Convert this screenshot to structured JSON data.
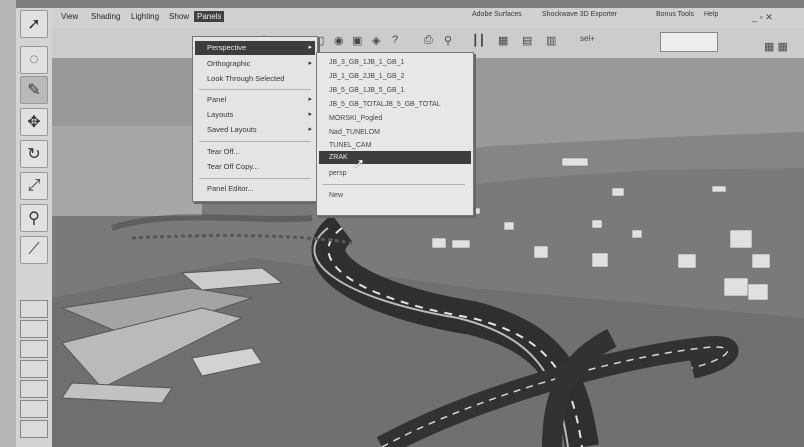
{
  "menubar": {
    "items": [
      "View",
      "Shading",
      "Lighting",
      "Show",
      "Panels"
    ],
    "active_index": 4,
    "right_items": [
      "Adobe Surfaces",
      "Shockwave 3D Exporter",
      "Bonus Tools",
      "Help"
    ]
  },
  "toolbar": {
    "field_prefix": "sel+",
    "field_value": ""
  },
  "panels_menu": {
    "items": [
      {
        "label": "Perspective",
        "submenu": true,
        "selected": true
      },
      {
        "label": "Orthographic",
        "submenu": true
      },
      {
        "label": "Look Through Selected"
      },
      {
        "separator": true
      },
      {
        "label": "Panel",
        "submenu": true
      },
      {
        "label": "Layouts",
        "submenu": true
      },
      {
        "label": "Saved Layouts",
        "submenu": true
      },
      {
        "separator": true
      },
      {
        "label": "Tear Off..."
      },
      {
        "label": "Tear Off Copy..."
      },
      {
        "separator": true
      },
      {
        "label": "Panel Editor..."
      }
    ]
  },
  "perspective_submenu": {
    "items": [
      "JB_3_GB_1JB_1_GB_1",
      "JB_1_GB_2JB_1_GB_2",
      "JB_5_GB_1JB_5_GB_1",
      "JB_5_GB_TOTALJB_5_GB_TOTAL",
      "MORSKI_Pogled",
      "Nad_TUNELOM",
      "TUNEL_CAM",
      "ZRAK",
      "persp",
      "New"
    ],
    "selected_index": 7
  },
  "icons": [
    "select-arrow-icon",
    "lasso-icon",
    "paint-icon",
    "move-icon",
    "rotate-icon",
    "scale-icon",
    "manipulator-icon",
    "measure-icon"
  ],
  "colors": {
    "menu_highlight": "#3a3a3a",
    "menu_bg": "#e9e9e9"
  }
}
